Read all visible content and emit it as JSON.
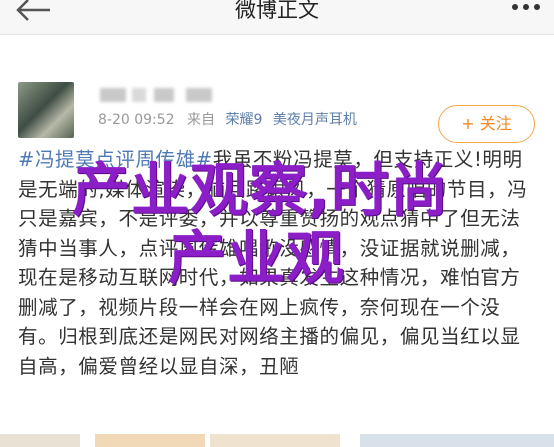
{
  "header": {
    "title": "微博正文"
  },
  "post": {
    "username": "",
    "time": "8-20 09:52",
    "source_prefix": "来自",
    "device1": "荣耀9",
    "device2": "美夜月声耳机",
    "follow_label": "+ 关注",
    "topic": "#冯提莫点评周传雄#",
    "text": "我虽不粉冯提莫，但支持正义!明明是无端的,媒体渲染，脑回路跟风，一个猜原唱的节目，冯只是嘉宾，不是评委，并以尊重赞扬的观点猜中了但无法猜中当事人，点评周传雄唱歌没感情，没证据就说删减，现在是移动互联网时代，如果真发生这种情况，难怕官方删减了，视频片段一样会在网上疯传，奈何现在一个没有。归根到底还是网民对网络主播的偏见，偏见当红以显自高，偏爱曾经以显自深，丑陋"
  },
  "watermark": {
    "line1": "产业观察,时尚",
    "line2": "产业观"
  },
  "colors": {
    "accent": "#f28a1f",
    "link": "#4f79b5",
    "watermark": "#8c1ec7"
  }
}
